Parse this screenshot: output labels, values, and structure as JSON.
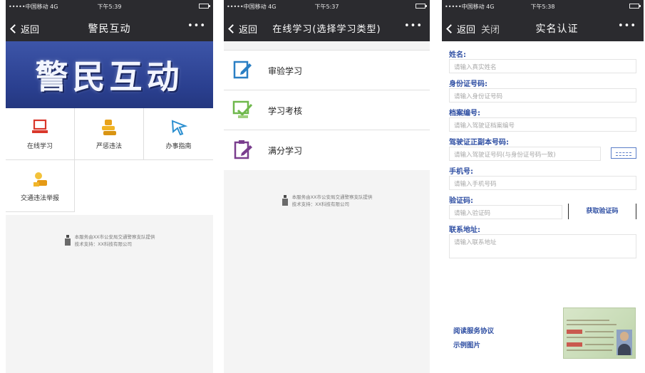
{
  "status": {
    "p1_left": "•••••中国移动 4G",
    "p1_time": "下午5:39",
    "p2_left": "•••••中国移动 4G",
    "p2_time": "下午5:37",
    "p3_left": "•••••中国移动 4G",
    "p3_time": "下午5:38"
  },
  "panel1": {
    "back_label": "返回",
    "title": "警民互动",
    "more": "•••",
    "banner_text": "警民互动",
    "grid": [
      {
        "label": "在线学习",
        "icon": "laptop-icon"
      },
      {
        "label": "严惩违法",
        "icon": "gold-stack-icon"
      },
      {
        "label": "办事指南",
        "icon": "cursor-icon"
      },
      {
        "label": "交通违法举报",
        "icon": "report-icon"
      }
    ],
    "footer_line1": "本服务由XX市公安局交通警察支队提供",
    "footer_line2": "技术支持：XX科技有限公司"
  },
  "panel2": {
    "back_label": "返回",
    "title": "在线学习(选择学习类型)",
    "more": "•••",
    "items": [
      {
        "label": "审验学习",
        "icon": "document-edit-icon"
      },
      {
        "label": "学习考核",
        "icon": "checklist-icon"
      },
      {
        "label": "满分学习",
        "icon": "clipboard-pen-icon"
      }
    ],
    "footer_line1": "本服务由XX市公安局交通警察支队提供",
    "footer_line2": "技术支持：XX科技有限公司"
  },
  "panel3": {
    "back_label": "返回",
    "close_label": "关闭",
    "title": "实名认证",
    "more": "•••",
    "fields": {
      "name_label": "姓名:",
      "name_placeholder": "请输入真实姓名",
      "id_label": "身份证号码:",
      "id_placeholder": "请输入身份证号码",
      "license_label": "档案编号:",
      "license_placeholder": "请输入驾驶证档案编号",
      "cert_label": "驾驶证正副本号码:",
      "cert_placeholder": "请输入驾驶证号码(与身份证号码一致)",
      "phone_label": "手机号:",
      "phone_placeholder": "请输入手机号码",
      "code_label": "验证码:",
      "code_placeholder": "请输入验证码",
      "code_button": "获取验证码",
      "address_label": "联系地址:",
      "address_placeholder": "请输入联系地址"
    },
    "links": {
      "agreement": "阅读服务协议",
      "sample": "示例图片"
    }
  },
  "colors": {
    "topbar": "#2b2b2f",
    "banner": "#2a3f8f",
    "accent": "#2f4fa3"
  }
}
